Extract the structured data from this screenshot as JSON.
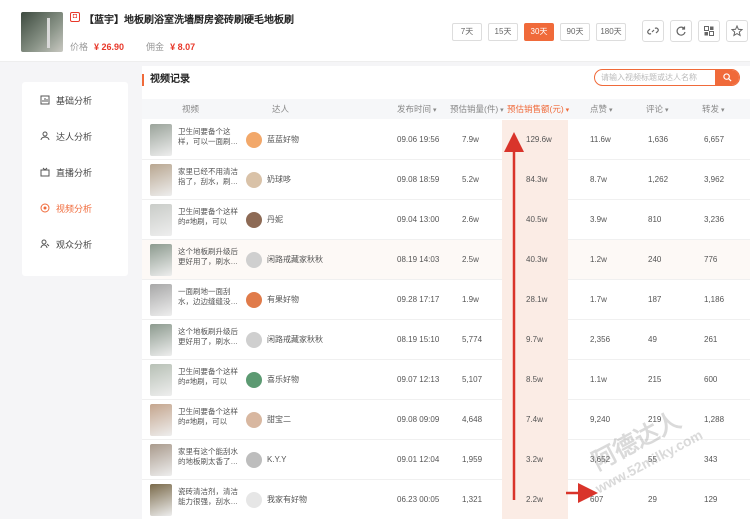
{
  "product": {
    "badge": "◘",
    "title": "【蓝宇】地板刷浴室洗墙厨房瓷砖刷硬毛地板刷",
    "price_label": "价格",
    "price_value": "¥ 26.90",
    "commission_label": "佣金",
    "commission_value": "¥ 8.07"
  },
  "ranges": [
    "7天",
    "15天",
    "30天",
    "90天",
    "180天"
  ],
  "active_range": 2,
  "nav": [
    {
      "label": "基础分析",
      "icon": "chart-icon"
    },
    {
      "label": "达人分析",
      "icon": "user-icon"
    },
    {
      "label": "直播分析",
      "icon": "live-icon"
    },
    {
      "label": "视频分析",
      "icon": "video-icon"
    },
    {
      "label": "观众分析",
      "icon": "audience-icon"
    }
  ],
  "active_nav": 3,
  "section_title": "视频记录",
  "search": {
    "placeholder": "请输入视频标题或达人名称"
  },
  "columns": [
    "视频",
    "达人",
    "发布时间",
    "预估销量(件)",
    "预估销售额(元)",
    "点赞",
    "评论",
    "转发"
  ],
  "rows": [
    {
      "desc": "卫生间要备个这样，可以一面刷…",
      "anchor": "蓝蓝好物",
      "time": "09.06 19:56",
      "sales": "7.9w",
      "revenue": "129.6w",
      "likes": "11.6w",
      "comments": "1,636",
      "shares": "6,657",
      "thumb": "#9aa39a",
      "avatar": "#f2a86a"
    },
    {
      "desc": "家里已经不用清洁指了，刮水，刷…",
      "anchor": "奶球哆",
      "time": "09.08 18:59",
      "sales": "5.2w",
      "revenue": "84.3w",
      "likes": "8.7w",
      "comments": "1,262",
      "shares": "3,962",
      "thumb": "#b8a690",
      "avatar": "#d9c2a8"
    },
    {
      "desc": "卫生间要备个这样的#地刷，可以一…",
      "anchor": "丹妮",
      "time": "09.04 13:00",
      "sales": "2.6w",
      "revenue": "40.5w",
      "likes": "3.9w",
      "comments": "810",
      "shares": "3,236",
      "thumb": "#c9ccc8",
      "avatar": "#8d6a55"
    },
    {
      "desc": "这个地板刷升级后更好用了，刷水…",
      "anchor": "闲路戒藏家秋秋",
      "time": "08.19 14:03",
      "sales": "2.5w",
      "revenue": "40.3w",
      "likes": "1.2w",
      "comments": "240",
      "shares": "776",
      "thumb": "#8c9a8e",
      "avatar": "#cfcfcf"
    },
    {
      "desc": "一面刷地一面刮水，边边缝缝没…",
      "anchor": "有果好物",
      "time": "09.28 17:17",
      "sales": "1.9w",
      "revenue": "28.1w",
      "likes": "1.7w",
      "comments": "187",
      "shares": "1,186",
      "thumb": "#a7a7a7",
      "avatar": "#e07b4a"
    },
    {
      "desc": "这个地板刷升级后更好用了，刷水…",
      "anchor": "闲路戒藏家秋秋",
      "time": "08.19 15:10",
      "sales": "5,774",
      "revenue": "9.7w",
      "likes": "2,356",
      "comments": "49",
      "shares": "261",
      "thumb": "#8c9a8e",
      "avatar": "#cfcfcf"
    },
    {
      "desc": "卫生间要备个这样的#地刷，可以一…",
      "anchor": "喜乐好物",
      "time": "09.07 12:13",
      "sales": "5,107",
      "revenue": "8.5w",
      "likes": "1.1w",
      "comments": "215",
      "shares": "600",
      "thumb": "#b7c0b5",
      "avatar": "#5c9a72"
    },
    {
      "desc": "卫生间要备个这样的#地刷，可以一…",
      "anchor": "甜宝二",
      "time": "09.08 09:09",
      "sales": "4,648",
      "revenue": "7.4w",
      "likes": "9,240",
      "comments": "219",
      "shares": "1,288",
      "thumb": "#c4a58d",
      "avatar": "#d8b7a0"
    },
    {
      "desc": "家里有这个能刮水的地板刷太香了…",
      "anchor": "K.Y.Y",
      "time": "09.01 12:04",
      "sales": "1,959",
      "revenue": "3.2w",
      "likes": "3,652",
      "comments": "55",
      "shares": "343",
      "thumb": "#a99a8c",
      "avatar": "#bdbdbd"
    },
    {
      "desc": "瓷砖清洁剂，清洁能力很强，刮水…",
      "anchor": "我家有好物",
      "time": "06.23 00:05",
      "sales": "1,321",
      "revenue": "2.2w",
      "likes": "607",
      "comments": "29",
      "shares": "129",
      "thumb": "#7a6a4a",
      "avatar": "#e6e6e6"
    }
  ],
  "watermark": {
    "line1": "阿德达人",
    "line2": "www.52milky.com"
  },
  "colors": {
    "accent": "#f06a3a",
    "price": "#e8382a",
    "arrow": "#d9342b"
  }
}
